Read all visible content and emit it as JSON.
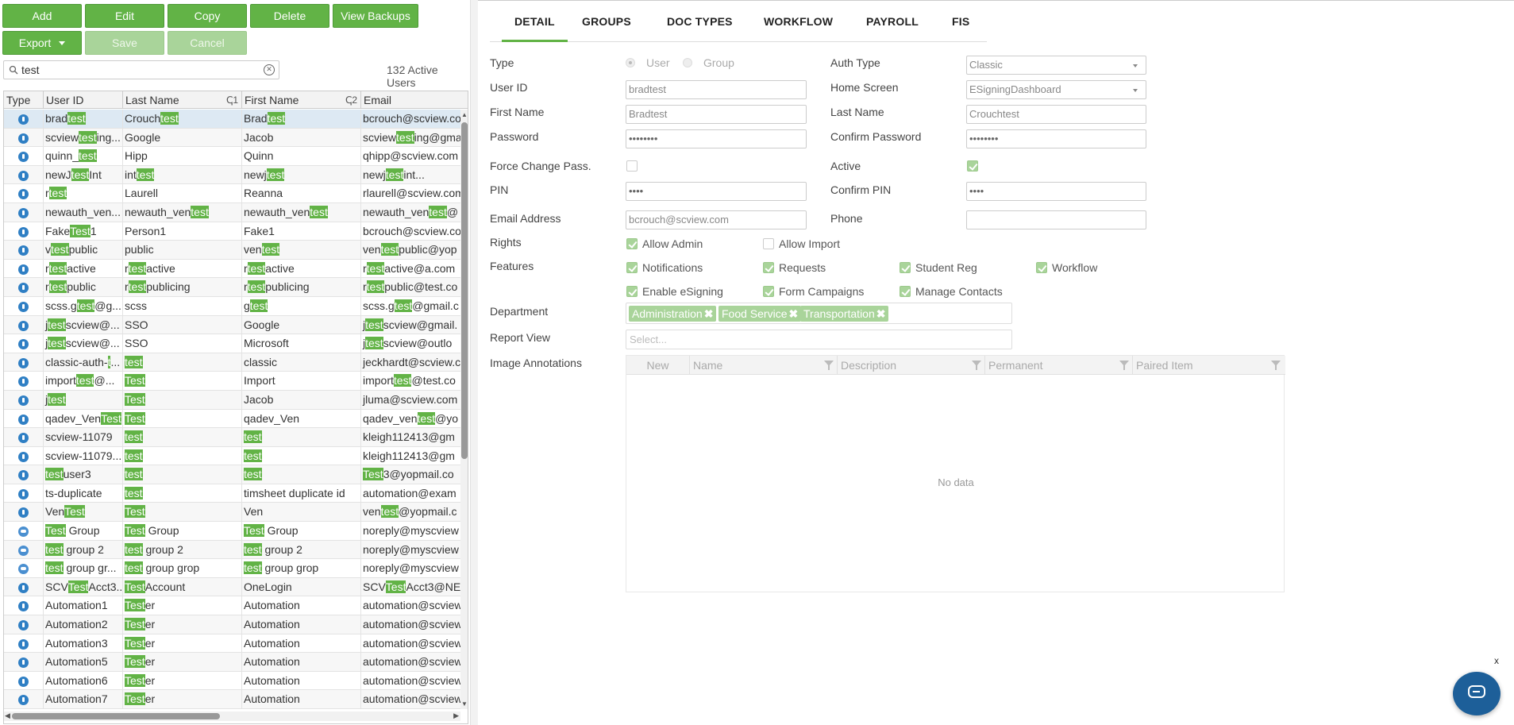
{
  "toolbar": {
    "add": "Add",
    "edit": "Edit",
    "copy": "Copy",
    "delete": "Delete",
    "view_backups": "View Backups",
    "export": "Export",
    "save": "Save",
    "cancel": "Cancel"
  },
  "search": {
    "value": "test",
    "active_count": "132 Active Users"
  },
  "grid": {
    "columns": [
      "Type",
      "User ID",
      "Last Name",
      "First Name",
      "Email"
    ],
    "sort_last": "ↅ1",
    "sort_first": "ↅ2",
    "rows": [
      {
        "t": "user",
        "c": [
          [
            "brad",
            "test",
            ""
          ],
          [
            "Crouch",
            "test",
            ""
          ],
          [
            "Brad",
            "test",
            ""
          ],
          [
            "bcrouch@scview.com",
            "",
            ""
          ]
        ]
      },
      {
        "t": "user",
        "c": [
          [
            "scview",
            "test",
            "ing..."
          ],
          [
            "Google",
            "",
            ""
          ],
          [
            "Jacob",
            "",
            ""
          ],
          [
            "scview",
            "test",
            "ing@gma"
          ]
        ]
      },
      {
        "t": "user",
        "c": [
          [
            "quinn_",
            "test",
            ""
          ],
          [
            "Hipp",
            "",
            ""
          ],
          [
            "Quinn",
            "",
            ""
          ],
          [
            "qhipp@scview.com",
            "",
            ""
          ]
        ]
      },
      {
        "t": "user",
        "c": [
          [
            "newJ",
            "test",
            "Int"
          ],
          [
            "int",
            "test",
            ""
          ],
          [
            "newj",
            "test",
            ""
          ],
          [
            "newj",
            "test",
            "int..."
          ]
        ]
      },
      {
        "t": "user",
        "c": [
          [
            "r",
            "test",
            ""
          ],
          [
            "Laurell",
            "",
            ""
          ],
          [
            "Reanna",
            "",
            ""
          ],
          [
            "rlaurell@scview.com",
            "",
            ""
          ]
        ]
      },
      {
        "t": "user",
        "c": [
          [
            "newauth_ven...",
            "",
            ""
          ],
          [
            "newauth_ven",
            "test",
            ""
          ],
          [
            "newauth_ven",
            "test",
            ""
          ],
          [
            "newauth_ven",
            "test",
            "@"
          ]
        ]
      },
      {
        "t": "user",
        "c": [
          [
            "Fake",
            "Test",
            "1"
          ],
          [
            "Person1",
            "",
            ""
          ],
          [
            "Fake1",
            "",
            ""
          ],
          [
            "bcrouch@scview.com",
            "",
            ""
          ]
        ]
      },
      {
        "t": "user",
        "c": [
          [
            "v",
            "test",
            "public"
          ],
          [
            "public",
            "",
            ""
          ],
          [
            "ven",
            "test",
            ""
          ],
          [
            "ven",
            "test",
            "public@yop"
          ]
        ]
      },
      {
        "t": "user",
        "c": [
          [
            "r",
            "test",
            "active"
          ],
          [
            "r",
            "test",
            "active"
          ],
          [
            "r",
            "test",
            "active"
          ],
          [
            "r",
            "test",
            "active@a.com"
          ]
        ]
      },
      {
        "t": "user",
        "c": [
          [
            "r",
            "test",
            "public"
          ],
          [
            "r",
            "test",
            "publicing"
          ],
          [
            "r",
            "test",
            "publicing"
          ],
          [
            "r",
            "test",
            "public@test.co"
          ]
        ]
      },
      {
        "t": "user",
        "c": [
          [
            "scss.g",
            "test",
            "@g..."
          ],
          [
            "scss",
            "",
            ""
          ],
          [
            "g",
            "test",
            ""
          ],
          [
            "scss.g",
            "test",
            "@gmail.c"
          ]
        ]
      },
      {
        "t": "user",
        "c": [
          [
            "j",
            "test",
            "scview@..."
          ],
          [
            "SSO",
            "",
            ""
          ],
          [
            "Google",
            "",
            ""
          ],
          [
            "j",
            "test",
            "scview@gmail."
          ]
        ]
      },
      {
        "t": "user",
        "c": [
          [
            "j",
            "test",
            "scview@..."
          ],
          [
            "SSO",
            "",
            ""
          ],
          [
            "Microsoft",
            "",
            ""
          ],
          [
            "j",
            "test",
            "scview@outlo"
          ]
        ]
      },
      {
        "t": "user",
        "c": [
          [
            "classic-auth-",
            "t",
            "..."
          ],
          [
            "",
            "test",
            ""
          ],
          [
            "classic",
            "",
            ""
          ],
          [
            "jeckhardt@scview.c",
            "",
            ""
          ]
        ]
      },
      {
        "t": "user",
        "c": [
          [
            "import",
            "test",
            "@..."
          ],
          [
            "",
            "Test",
            ""
          ],
          [
            "Import",
            "",
            ""
          ],
          [
            "import",
            "test",
            "@test.co"
          ]
        ]
      },
      {
        "t": "user",
        "c": [
          [
            "j",
            "test",
            ""
          ],
          [
            "",
            "Test",
            ""
          ],
          [
            "Jacob",
            "",
            ""
          ],
          [
            "jluma@scview.com",
            "",
            ""
          ]
        ]
      },
      {
        "t": "user",
        "c": [
          [
            "qadev_Ven",
            "Test",
            ""
          ],
          [
            "",
            "Test",
            ""
          ],
          [
            "qadev_Ven",
            "",
            ""
          ],
          [
            "qadev_ven",
            "test",
            "@yo"
          ]
        ]
      },
      {
        "t": "user",
        "c": [
          [
            "scview-11079",
            "",
            ""
          ],
          [
            "",
            "test",
            ""
          ],
          [
            "",
            "test",
            ""
          ],
          [
            "kleigh112413@gm",
            "",
            ""
          ]
        ]
      },
      {
        "t": "user",
        "c": [
          [
            "scview-11079...",
            "",
            ""
          ],
          [
            "",
            "test",
            ""
          ],
          [
            "",
            "test",
            ""
          ],
          [
            "kleigh112413@gm",
            "",
            ""
          ]
        ]
      },
      {
        "t": "user",
        "c": [
          [
            "",
            "test",
            "user3"
          ],
          [
            "",
            "test",
            ""
          ],
          [
            "",
            "test",
            ""
          ],
          [
            "",
            "Test",
            "3@yopmail.co"
          ]
        ]
      },
      {
        "t": "user",
        "c": [
          [
            "ts-duplicate",
            "",
            ""
          ],
          [
            "",
            "test",
            ""
          ],
          [
            "timsheet duplicate id",
            "",
            ""
          ],
          [
            "automation@exam",
            "",
            ""
          ]
        ]
      },
      {
        "t": "user",
        "c": [
          [
            "Ven",
            "Test",
            ""
          ],
          [
            "",
            "Test",
            ""
          ],
          [
            "Ven",
            "",
            ""
          ],
          [
            "ven",
            "test",
            "@yopmail.c"
          ]
        ]
      },
      {
        "t": "group",
        "c": [
          [
            "",
            "Test",
            " Group"
          ],
          [
            "",
            "Test",
            " Group"
          ],
          [
            "",
            "Test",
            " Group"
          ],
          [
            "noreply@myscview",
            "",
            ""
          ]
        ]
      },
      {
        "t": "group",
        "c": [
          [
            "",
            "test",
            " group 2"
          ],
          [
            "",
            "test",
            " group 2"
          ],
          [
            "",
            "test",
            " group 2"
          ],
          [
            "noreply@myscview",
            "",
            ""
          ]
        ]
      },
      {
        "t": "group",
        "c": [
          [
            "",
            "test",
            " group gr..."
          ],
          [
            "",
            "test",
            " group grop"
          ],
          [
            "",
            "test",
            " group grop"
          ],
          [
            "noreply@myscview",
            "",
            ""
          ]
        ]
      },
      {
        "t": "user",
        "c": [
          [
            "SCV",
            "Test",
            "Acct3..."
          ],
          [
            "",
            "Test",
            "Account"
          ],
          [
            "OneLogin",
            "",
            ""
          ],
          [
            "SCV",
            "Test",
            "Acct3@NET"
          ]
        ]
      },
      {
        "t": "user",
        "c": [
          [
            "Automation1",
            "",
            ""
          ],
          [
            "",
            "Test",
            "er"
          ],
          [
            "Automation",
            "",
            ""
          ],
          [
            "automation@scview",
            "",
            ""
          ]
        ]
      },
      {
        "t": "user",
        "c": [
          [
            "Automation2",
            "",
            ""
          ],
          [
            "",
            "Test",
            "er"
          ],
          [
            "Automation",
            "",
            ""
          ],
          [
            "automation@scview",
            "",
            ""
          ]
        ]
      },
      {
        "t": "user",
        "c": [
          [
            "Automation3",
            "",
            ""
          ],
          [
            "",
            "Test",
            "er"
          ],
          [
            "Automation",
            "",
            ""
          ],
          [
            "automation@scview",
            "",
            ""
          ]
        ]
      },
      {
        "t": "user",
        "c": [
          [
            "Automation5",
            "",
            ""
          ],
          [
            "",
            "Test",
            "er"
          ],
          [
            "Automation",
            "",
            ""
          ],
          [
            "automation@scview",
            "",
            ""
          ]
        ]
      },
      {
        "t": "user",
        "c": [
          [
            "Automation6",
            "",
            ""
          ],
          [
            "",
            "Test",
            "er"
          ],
          [
            "Automation",
            "",
            ""
          ],
          [
            "automation@scview",
            "",
            ""
          ]
        ]
      },
      {
        "t": "user",
        "c": [
          [
            "Automation7",
            "",
            ""
          ],
          [
            "",
            "Test",
            "er"
          ],
          [
            "Automation",
            "",
            ""
          ],
          [
            "automation@scview",
            "",
            ""
          ]
        ]
      }
    ]
  },
  "tabs": [
    "DETAIL",
    "GROUPS",
    "DOC TYPES",
    "WORKFLOW",
    "PAYROLL",
    "FIS"
  ],
  "detail": {
    "type_label": "Type",
    "type_user": "User",
    "type_group": "Group",
    "auth_type_label": "Auth Type",
    "auth_type_value": "Classic",
    "user_id_label": "User ID",
    "user_id_value": "bradtest",
    "home_screen_label": "Home Screen",
    "home_screen_value": "ESigningDashboard",
    "first_name_label": "First Name",
    "first_name_value": "Bradtest",
    "last_name_label": "Last Name",
    "last_name_value": "Crouchtest",
    "password_label": "Password",
    "password_value": "••••••••",
    "confirm_password_label": "Confirm Password",
    "confirm_password_value": "••••••••",
    "force_change_label": "Force Change Pass.",
    "active_label": "Active",
    "pin_label": "PIN",
    "pin_value": "••••",
    "confirm_pin_label": "Confirm PIN",
    "confirm_pin_value": "••••",
    "email_label": "Email Address",
    "email_value": "bcrouch@scview.com",
    "phone_label": "Phone",
    "phone_value": "",
    "rights_label": "Rights",
    "allow_admin": "Allow Admin",
    "allow_import": "Allow Import",
    "features_label": "Features",
    "notifications": "Notifications",
    "requests": "Requests",
    "student_reg": "Student Reg",
    "workflow": "Workflow",
    "enable_esigning": "Enable eSigning",
    "form_campaigns": "Form Campaigns",
    "manage_contacts": "Manage Contacts",
    "department_label": "Department",
    "departments": [
      "Administration",
      "Food Service",
      "Transportation"
    ],
    "report_view_label": "Report View",
    "report_view_placeholder": "Select...",
    "image_annotations_label": "Image Annotations",
    "annotation_columns": [
      "New",
      "Name",
      "Description",
      "Permanent",
      "Paired Item"
    ],
    "no_data": "No data"
  },
  "chat": {
    "close": "x"
  }
}
